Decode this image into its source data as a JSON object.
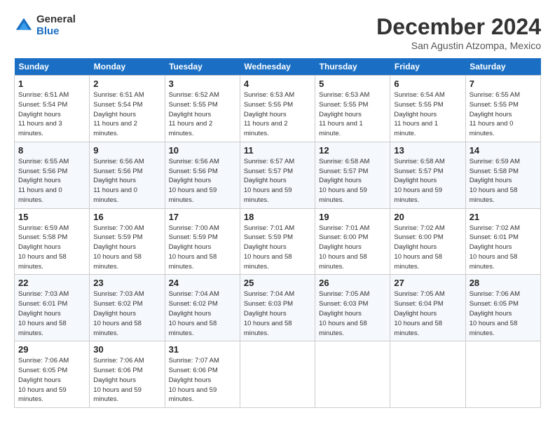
{
  "logo": {
    "general": "General",
    "blue": "Blue"
  },
  "title": "December 2024",
  "subtitle": "San Agustin Atzompa, Mexico",
  "days_of_week": [
    "Sunday",
    "Monday",
    "Tuesday",
    "Wednesday",
    "Thursday",
    "Friday",
    "Saturday"
  ],
  "weeks": [
    [
      {
        "day": "1",
        "sunrise": "6:51 AM",
        "sunset": "5:54 PM",
        "daylight": "11 hours and 3 minutes."
      },
      {
        "day": "2",
        "sunrise": "6:51 AM",
        "sunset": "5:54 PM",
        "daylight": "11 hours and 2 minutes."
      },
      {
        "day": "3",
        "sunrise": "6:52 AM",
        "sunset": "5:55 PM",
        "daylight": "11 hours and 2 minutes."
      },
      {
        "day": "4",
        "sunrise": "6:53 AM",
        "sunset": "5:55 PM",
        "daylight": "11 hours and 2 minutes."
      },
      {
        "day": "5",
        "sunrise": "6:53 AM",
        "sunset": "5:55 PM",
        "daylight": "11 hours and 1 minute."
      },
      {
        "day": "6",
        "sunrise": "6:54 AM",
        "sunset": "5:55 PM",
        "daylight": "11 hours and 1 minute."
      },
      {
        "day": "7",
        "sunrise": "6:55 AM",
        "sunset": "5:55 PM",
        "daylight": "11 hours and 0 minutes."
      }
    ],
    [
      {
        "day": "8",
        "sunrise": "6:55 AM",
        "sunset": "5:56 PM",
        "daylight": "11 hours and 0 minutes."
      },
      {
        "day": "9",
        "sunrise": "6:56 AM",
        "sunset": "5:56 PM",
        "daylight": "11 hours and 0 minutes."
      },
      {
        "day": "10",
        "sunrise": "6:56 AM",
        "sunset": "5:56 PM",
        "daylight": "10 hours and 59 minutes."
      },
      {
        "day": "11",
        "sunrise": "6:57 AM",
        "sunset": "5:57 PM",
        "daylight": "10 hours and 59 minutes."
      },
      {
        "day": "12",
        "sunrise": "6:58 AM",
        "sunset": "5:57 PM",
        "daylight": "10 hours and 59 minutes."
      },
      {
        "day": "13",
        "sunrise": "6:58 AM",
        "sunset": "5:57 PM",
        "daylight": "10 hours and 59 minutes."
      },
      {
        "day": "14",
        "sunrise": "6:59 AM",
        "sunset": "5:58 PM",
        "daylight": "10 hours and 58 minutes."
      }
    ],
    [
      {
        "day": "15",
        "sunrise": "6:59 AM",
        "sunset": "5:58 PM",
        "daylight": "10 hours and 58 minutes."
      },
      {
        "day": "16",
        "sunrise": "7:00 AM",
        "sunset": "5:59 PM",
        "daylight": "10 hours and 58 minutes."
      },
      {
        "day": "17",
        "sunrise": "7:00 AM",
        "sunset": "5:59 PM",
        "daylight": "10 hours and 58 minutes."
      },
      {
        "day": "18",
        "sunrise": "7:01 AM",
        "sunset": "5:59 PM",
        "daylight": "10 hours and 58 minutes."
      },
      {
        "day": "19",
        "sunrise": "7:01 AM",
        "sunset": "6:00 PM",
        "daylight": "10 hours and 58 minutes."
      },
      {
        "day": "20",
        "sunrise": "7:02 AM",
        "sunset": "6:00 PM",
        "daylight": "10 hours and 58 minutes."
      },
      {
        "day": "21",
        "sunrise": "7:02 AM",
        "sunset": "6:01 PM",
        "daylight": "10 hours and 58 minutes."
      }
    ],
    [
      {
        "day": "22",
        "sunrise": "7:03 AM",
        "sunset": "6:01 PM",
        "daylight": "10 hours and 58 minutes."
      },
      {
        "day": "23",
        "sunrise": "7:03 AM",
        "sunset": "6:02 PM",
        "daylight": "10 hours and 58 minutes."
      },
      {
        "day": "24",
        "sunrise": "7:04 AM",
        "sunset": "6:02 PM",
        "daylight": "10 hours and 58 minutes."
      },
      {
        "day": "25",
        "sunrise": "7:04 AM",
        "sunset": "6:03 PM",
        "daylight": "10 hours and 58 minutes."
      },
      {
        "day": "26",
        "sunrise": "7:05 AM",
        "sunset": "6:03 PM",
        "daylight": "10 hours and 58 minutes."
      },
      {
        "day": "27",
        "sunrise": "7:05 AM",
        "sunset": "6:04 PM",
        "daylight": "10 hours and 58 minutes."
      },
      {
        "day": "28",
        "sunrise": "7:06 AM",
        "sunset": "6:05 PM",
        "daylight": "10 hours and 58 minutes."
      }
    ],
    [
      {
        "day": "29",
        "sunrise": "7:06 AM",
        "sunset": "6:05 PM",
        "daylight": "10 hours and 59 minutes."
      },
      {
        "day": "30",
        "sunrise": "7:06 AM",
        "sunset": "6:06 PM",
        "daylight": "10 hours and 59 minutes."
      },
      {
        "day": "31",
        "sunrise": "7:07 AM",
        "sunset": "6:06 PM",
        "daylight": "10 hours and 59 minutes."
      },
      null,
      null,
      null,
      null
    ]
  ]
}
